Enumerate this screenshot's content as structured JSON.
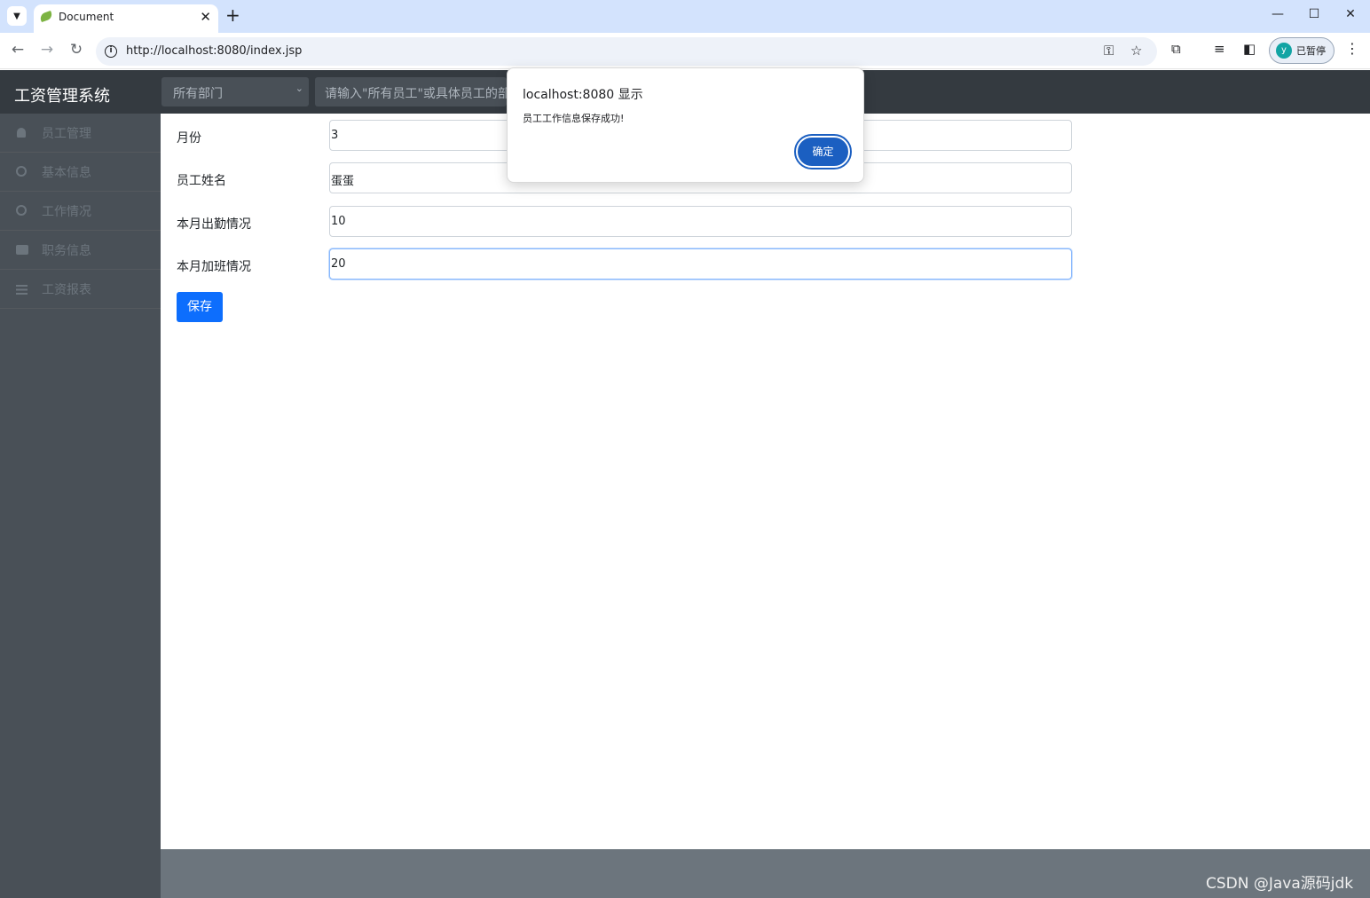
{
  "browser": {
    "tab_title": "Document",
    "url": "http://localhost:8080/index.jsp",
    "profile_initial": "y",
    "profile_label": "已暂停"
  },
  "app": {
    "brand": "工资管理系统",
    "department_select": "所有部门",
    "search_placeholder": "请输入\"所有员工\"或具体员工的部"
  },
  "sidebar": {
    "items": [
      {
        "label": "员工管理",
        "icon": "user-icon"
      },
      {
        "label": "基本信息",
        "icon": "circle-icon"
      },
      {
        "label": "工作情况",
        "icon": "circle-icon"
      },
      {
        "label": "职务信息",
        "icon": "briefcase-icon"
      },
      {
        "label": "工资报表",
        "icon": "list-icon"
      }
    ]
  },
  "form": {
    "fields": [
      {
        "label": "月份",
        "value": "3"
      },
      {
        "label": "员工姓名",
        "value": "蛋蛋"
      },
      {
        "label": "本月出勤情况",
        "value": "10"
      },
      {
        "label": "本月加班情况",
        "value": "20"
      }
    ],
    "save_label": "保存"
  },
  "dialog": {
    "title": "localhost:8080 显示",
    "message": "员工工作信息保存成功!",
    "ok_label": "确定"
  },
  "watermark": "CSDN @Java源码jdk",
  "colors": {
    "header": "#343a40",
    "sidebar": "#495057",
    "primary": "#0d6efd",
    "footer": "#6c757d"
  }
}
